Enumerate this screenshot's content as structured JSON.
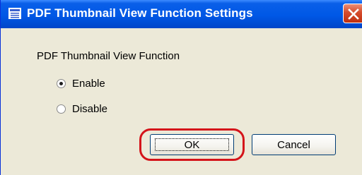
{
  "window": {
    "title": "PDF Thumbnail View Function Settings",
    "titlebar_color": "#0058e6",
    "close_color": "#d54b2b"
  },
  "group": {
    "label": "PDF Thumbnail View Function",
    "options": [
      {
        "label": "Enable",
        "selected": true
      },
      {
        "label": "Disable",
        "selected": false
      }
    ]
  },
  "buttons": {
    "ok_label": "OK",
    "cancel_label": "Cancel"
  },
  "annotation": {
    "highlight_color": "#d4141a",
    "highlighted": "ok-button"
  }
}
